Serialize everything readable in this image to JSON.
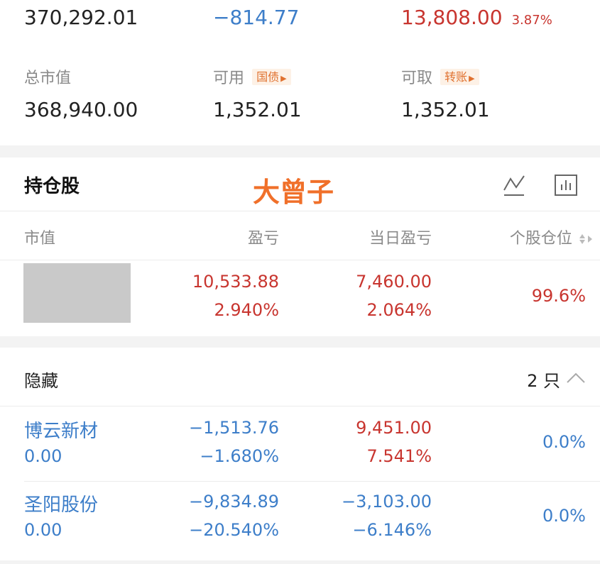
{
  "account": {
    "top_total": "370,292.01",
    "top_change": "−814.77",
    "top_profit": "13,808.00",
    "top_profit_pct": "3.87%",
    "market_value_label": "总市值",
    "market_value": "368,940.00",
    "available_label": "可用",
    "available_tag": "国债",
    "available": "1,352.01",
    "withdrawable_label": "可取",
    "withdrawable_tag": "转账",
    "withdrawable": "1,352.01"
  },
  "holdings": {
    "title": "持仓股",
    "watermark": "大曾子",
    "icons": [
      "trend-line-icon",
      "bar-chart-icon"
    ],
    "columns": {
      "market_value": "市值",
      "profit": "盈亏",
      "day_profit": "当日盈亏",
      "position": "个股仓位"
    },
    "rows": [
      {
        "profit": "10,533.88",
        "profit_pct": "2.940%",
        "day_profit": "7,460.00",
        "day_profit_pct": "2.064%",
        "position": "99.6%"
      }
    ]
  },
  "hidden": {
    "label": "隐藏",
    "count": "2 只",
    "rows": [
      {
        "name": "博云新材",
        "value": "0.00",
        "profit": "−1,513.76",
        "profit_pct": "−1.680%",
        "day_profit": "9,451.00",
        "day_profit_pct": "7.541%",
        "position": "0.0%"
      },
      {
        "name": "圣阳股份",
        "value": "0.00",
        "profit": "−9,834.89",
        "profit_pct": "−20.540%",
        "day_profit": "−3,103.00",
        "day_profit_pct": "−6.146%",
        "position": "0.0%"
      }
    ]
  },
  "colors": {
    "gain": "#c8352f",
    "loss_link": "#3d7ec9",
    "accent": "#e0712f",
    "watermark": "#f0702a"
  }
}
